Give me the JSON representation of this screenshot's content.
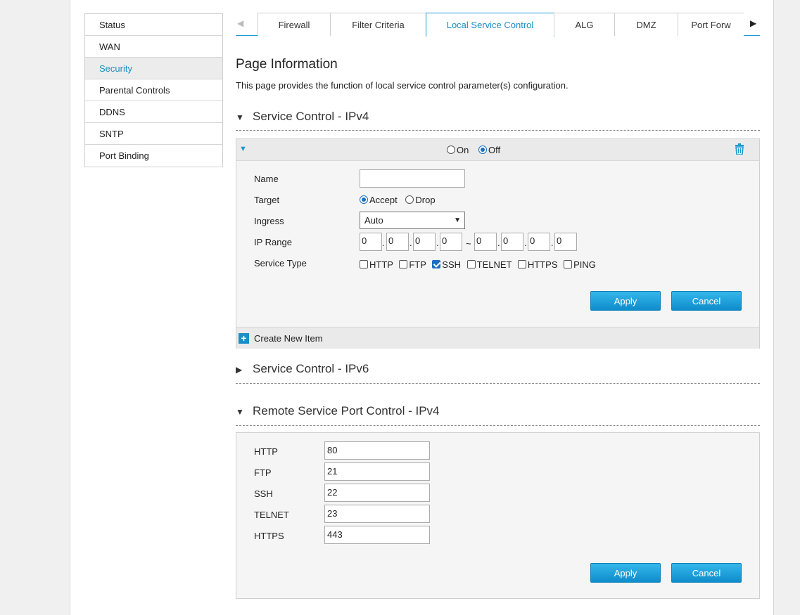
{
  "sidebar": {
    "items": [
      {
        "label": "Status",
        "active": false
      },
      {
        "label": "WAN",
        "active": false
      },
      {
        "label": "Security",
        "active": true
      },
      {
        "label": "Parental Controls",
        "active": false
      },
      {
        "label": "DDNS",
        "active": false
      },
      {
        "label": "SNTP",
        "active": false
      },
      {
        "label": "Port Binding",
        "active": false
      }
    ]
  },
  "tabs": {
    "items": [
      "Firewall",
      "Filter Criteria",
      "Local Service Control",
      "ALG",
      "DMZ",
      "Port Forw"
    ],
    "active": "Local Service Control",
    "left_arrow": "◀",
    "right_arrow": "▶"
  },
  "page": {
    "title": "Page Information",
    "description": "This page provides the function of local service control parameter(s) configuration."
  },
  "service_control_ipv4": {
    "heading": "Service Control - IPv4",
    "expanded_icon": "▼",
    "item": {
      "on_label": "On",
      "off_label": "Off",
      "selected": "Off",
      "name_label": "Name",
      "name_value": "",
      "target_label": "Target",
      "target_options": [
        "Accept",
        "Drop"
      ],
      "target_selected": "Accept",
      "ingress_label": "Ingress",
      "ingress_value": "Auto",
      "ip_range_label": "IP Range",
      "ip_start": [
        "0",
        "0",
        "0",
        "0"
      ],
      "ip_end": [
        "0",
        "0",
        "0",
        "0"
      ],
      "range_sep": "~",
      "service_type_label": "Service Type",
      "services": [
        {
          "label": "HTTP",
          "checked": false
        },
        {
          "label": "FTP",
          "checked": false
        },
        {
          "label": "SSH",
          "checked": true
        },
        {
          "label": "TELNET",
          "checked": false
        },
        {
          "label": "HTTPS",
          "checked": false
        },
        {
          "label": "PING",
          "checked": false
        }
      ],
      "apply_label": "Apply",
      "cancel_label": "Cancel"
    },
    "create_label": "Create New Item"
  },
  "service_control_ipv6": {
    "heading": "Service Control - IPv6",
    "collapsed_icon": "▶"
  },
  "remote_port_control": {
    "heading": "Remote Service Port Control - IPv4",
    "expanded_icon": "▼",
    "ports": [
      {
        "label": "HTTP",
        "value": "80"
      },
      {
        "label": "FTP",
        "value": "21"
      },
      {
        "label": "SSH",
        "value": "22"
      },
      {
        "label": "TELNET",
        "value": "23"
      },
      {
        "label": "HTTPS",
        "value": "443"
      }
    ],
    "apply_label": "Apply",
    "cancel_label": "Cancel"
  },
  "colors": {
    "accent": "#1a9ad1",
    "button": "#1a9ad1"
  }
}
